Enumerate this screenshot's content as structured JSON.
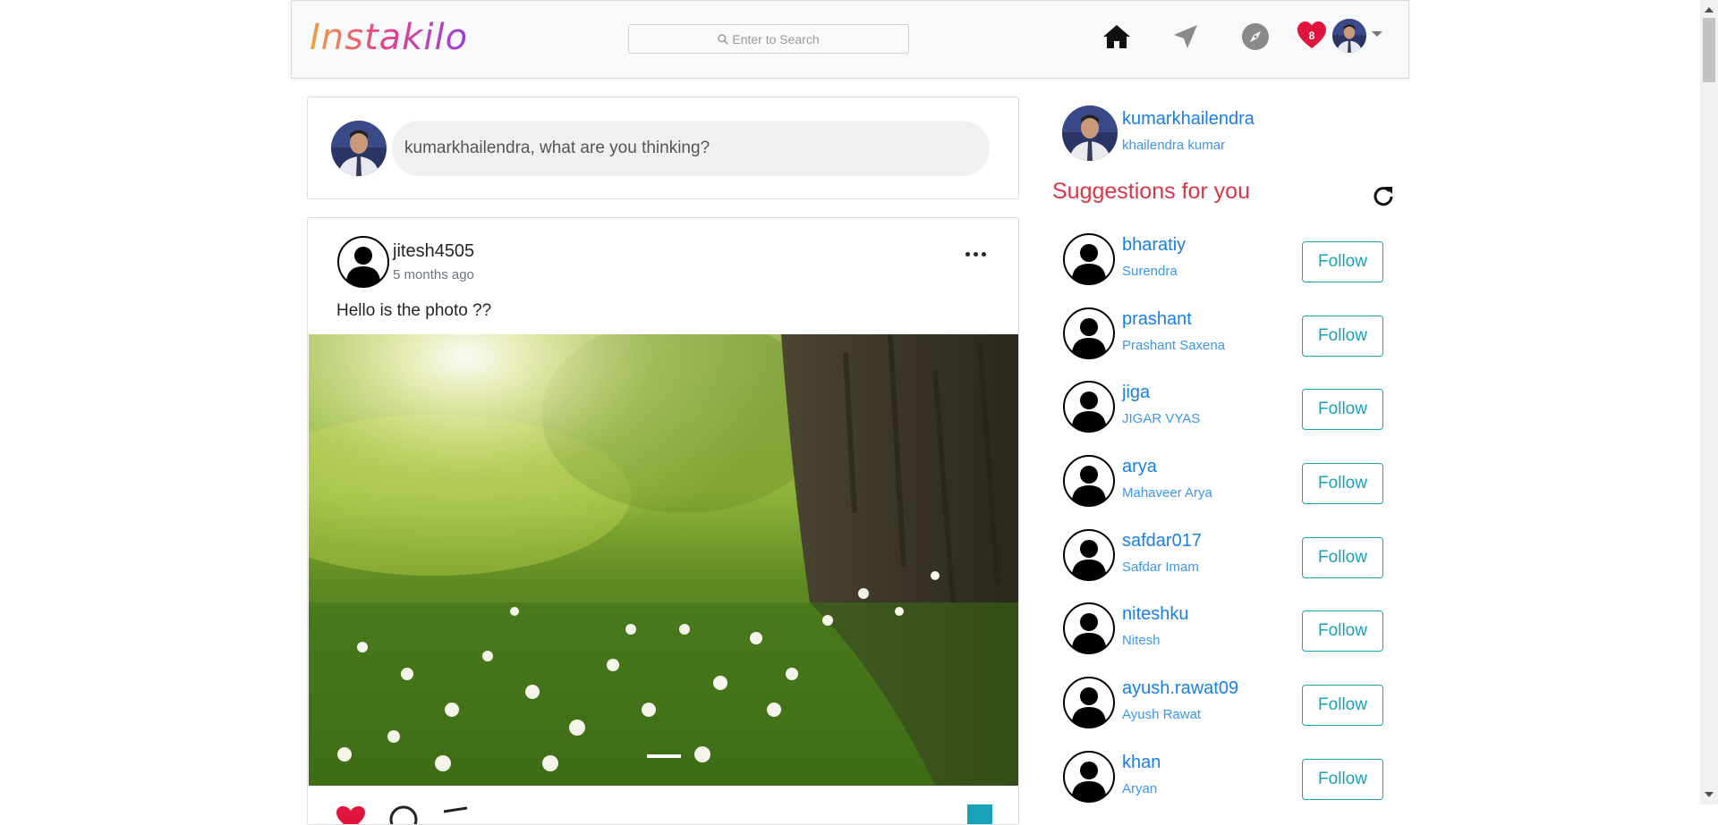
{
  "navbar": {
    "brand": "Instakilo",
    "search_placeholder": "Enter to Search",
    "notification_count": "8",
    "icons": [
      "home-icon",
      "send-icon",
      "compass-icon",
      "heart-icon"
    ]
  },
  "composer": {
    "placeholder": "kumarkhailendra, what are you thinking?"
  },
  "post": {
    "username": "jitesh4505",
    "time": "5 months ago",
    "caption": "Hello is the photo ??"
  },
  "me": {
    "username": "kumarkhailendra",
    "full_name": "khailendra kumar"
  },
  "suggestions": {
    "title": "Suggestions for you",
    "follow_label": "Follow",
    "items": [
      {
        "username": "bharatiy",
        "full_name": "Surendra"
      },
      {
        "username": "prashant",
        "full_name": "Prashant Saxena"
      },
      {
        "username": "jiga",
        "full_name": "JIGAR VYAS"
      },
      {
        "username": "arya",
        "full_name": "Mahaveer Arya"
      },
      {
        "username": "safdar017",
        "full_name": "Safdar Imam"
      },
      {
        "username": "niteshku",
        "full_name": "Nitesh"
      },
      {
        "username": "ayush.rawat09",
        "full_name": "Ayush Rawat"
      },
      {
        "username": "khan",
        "full_name": "Aryan"
      }
    ]
  },
  "colors": {
    "link": "#1a7ee6",
    "accent_red": "#dc3545",
    "follow_teal": "#17a2b8",
    "heart_red": "#e0143c"
  }
}
